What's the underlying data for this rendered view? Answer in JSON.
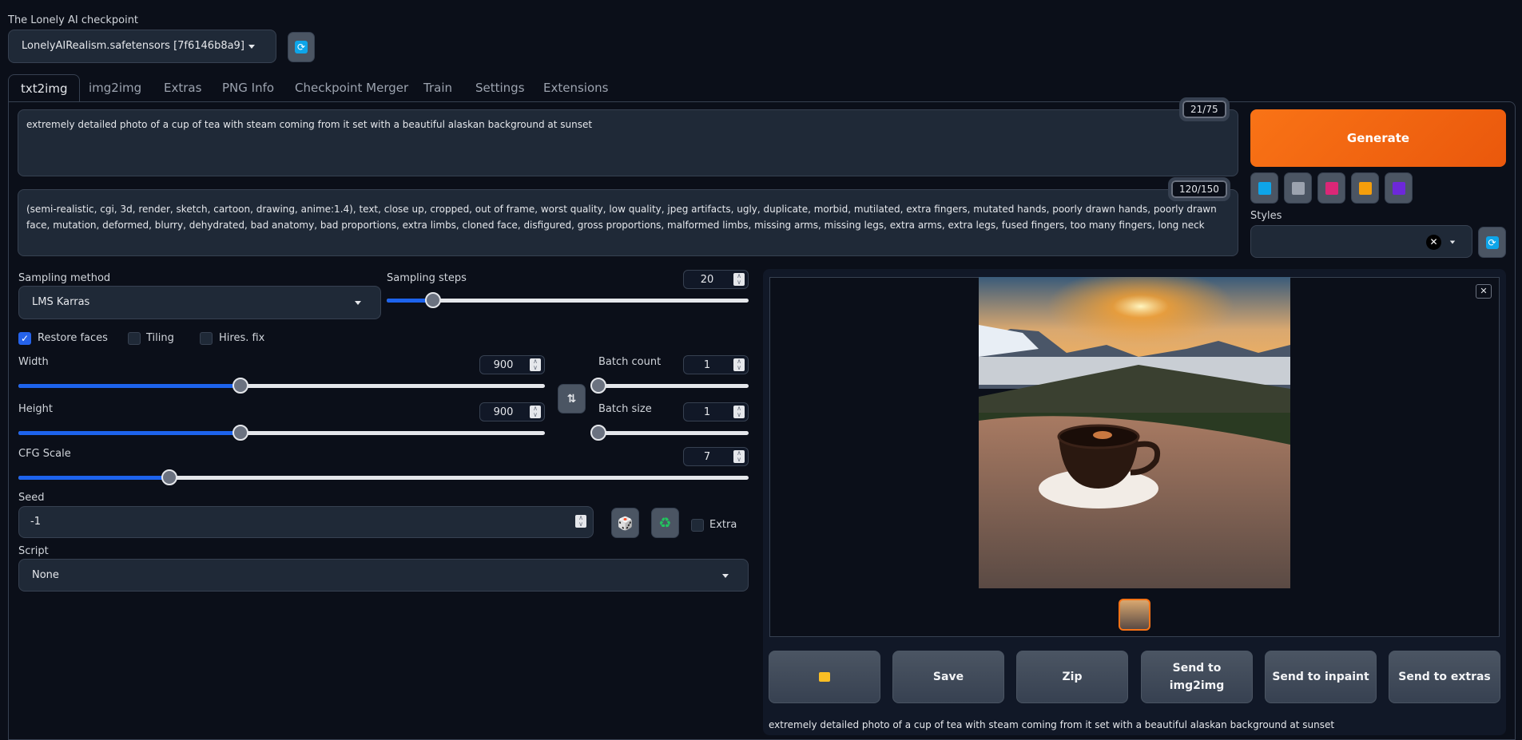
{
  "checkpoint": {
    "label": "The Lonely AI checkpoint",
    "value": "LonelyAIRealism.safetensors [7f6146b8a9]"
  },
  "tabs": [
    {
      "label": "txt2img",
      "active": true
    },
    {
      "label": "img2img"
    },
    {
      "label": "Extras"
    },
    {
      "label": "PNG Info"
    },
    {
      "label": "Checkpoint Merger"
    },
    {
      "label": "Train"
    },
    {
      "label": "Settings"
    },
    {
      "label": "Extensions"
    }
  ],
  "prompt": {
    "value": "extremely detailed photo of a cup of tea with steam coming from it set with a beautiful alaskan background at sunset",
    "counter": "21/75"
  },
  "negative_prompt": {
    "value": "(semi-realistic, cgi, 3d, render, sketch, cartoon, drawing, anime:1.4), text, close up, cropped, out of frame, worst quality, low quality, jpeg artifacts, ugly, duplicate, morbid, mutilated, extra fingers, mutated hands, poorly drawn hands, poorly drawn face, mutation, deformed, blurry, dehydrated, bad anatomy, bad proportions, extra limbs, cloned face, disfigured, gross proportions, malformed limbs, missing arms, missing legs, extra arms, extra legs, fused fingers, too many fingers, long neck",
    "counter": "120/150"
  },
  "generate_label": "Generate",
  "tool_icons": [
    "paste-arrow-icon",
    "trash-icon",
    "style-card-icon",
    "clipboard-icon",
    "floppy-save-icon"
  ],
  "styles": {
    "label": "Styles",
    "value": ""
  },
  "sampling_method": {
    "label": "Sampling method",
    "value": "LMS Karras"
  },
  "sampling_steps": {
    "label": "Sampling steps",
    "value": "20",
    "min": 1,
    "max": 150
  },
  "checkboxes": {
    "restore_faces": {
      "label": "Restore faces",
      "checked": true
    },
    "tiling": {
      "label": "Tiling",
      "checked": false
    },
    "hires_fix": {
      "label": "Hires. fix",
      "checked": false
    }
  },
  "width": {
    "label": "Width",
    "value": "900",
    "min": 64,
    "max": 2048
  },
  "height": {
    "label": "Height",
    "value": "900",
    "min": 64,
    "max": 2048
  },
  "batch_count": {
    "label": "Batch count",
    "value": "1",
    "min": 1,
    "max": 100
  },
  "batch_size": {
    "label": "Batch size",
    "value": "1",
    "min": 1,
    "max": 8
  },
  "cfg_scale": {
    "label": "CFG Scale",
    "value": "7",
    "min": 1,
    "max": 30
  },
  "seed": {
    "label": "Seed",
    "value": "-1",
    "extra_label": "Extra"
  },
  "script": {
    "label": "Script",
    "value": "None"
  },
  "output_buttons": {
    "folder": "folder-icon",
    "save": "Save",
    "zip": "Zip",
    "img2img": "Send to img2img",
    "inpaint": "Send to inpaint",
    "extras": "Send to extras"
  },
  "caption": "extremely detailed photo of a cup of tea with steam coming from it set with a beautiful alaskan background at sunset",
  "colors": {
    "accent": "#f97316",
    "slider": "#1d63ed",
    "background": "#0b0f19"
  }
}
